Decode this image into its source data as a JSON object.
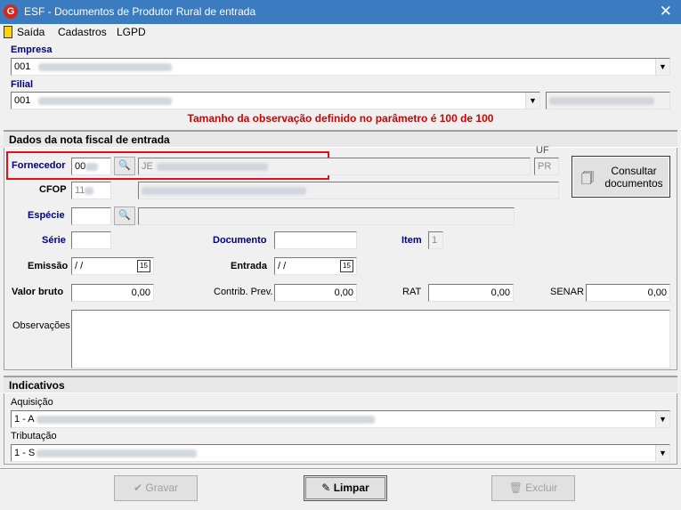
{
  "window": {
    "title": "ESF - Documentos de Produtor Rural de entrada",
    "close_glyph": "✕",
    "app_icon_letter": "G"
  },
  "menu": {
    "items": [
      "Saída",
      "Cadastros",
      "LGPD"
    ]
  },
  "empresa": {
    "label": "Empresa",
    "value": "001"
  },
  "filial": {
    "label": "Filial",
    "value": "001"
  },
  "message": "Tamanho da observação definido no parâmetro é 100 de 100",
  "nota": {
    "section_title": "Dados da nota fiscal de entrada",
    "fornecedor": {
      "label": "Fornecedor",
      "code": "00",
      "name": "JE",
      "uf_label": "UF",
      "uf": "PR"
    },
    "consultar_label_1": "Consultar",
    "consultar_label_2": "documentos",
    "cfop": {
      "label": "CFOP",
      "code": "11"
    },
    "especie": {
      "label": "Espécie",
      "value": ""
    },
    "serie": {
      "label": "Série",
      "value": ""
    },
    "documento": {
      "label": "Documento",
      "value": ""
    },
    "item": {
      "label": "Item",
      "value": "1"
    },
    "emissao": {
      "label": "Emissão",
      "value": " /  /"
    },
    "entrada": {
      "label": "Entrada",
      "value": " /  /"
    },
    "calendar_glyph": "15",
    "valor_bruto": {
      "label": "Valor bruto",
      "value": "0,00"
    },
    "contrib_prev": {
      "label": "Contrib. Prev.",
      "value": "0,00"
    },
    "rat": {
      "label": "RAT",
      "value": "0,00"
    },
    "senar": {
      "label": "SENAR",
      "value": "0,00"
    },
    "observacoes": {
      "label": "Observações",
      "value": ""
    }
  },
  "indicativos": {
    "section_title": "Indicativos",
    "aquisicao": {
      "label": "Aquisição",
      "value": "1 - A"
    },
    "tributacao": {
      "label": "Tributação",
      "value": "1 - S"
    }
  },
  "buttons": {
    "gravar": "Gravar",
    "limpar": "Limpar",
    "excluir": "Excluir"
  },
  "icons": {
    "search": "binoculars-icon",
    "calendar": "calendar-icon",
    "dropdown": "chevron-down-icon"
  }
}
